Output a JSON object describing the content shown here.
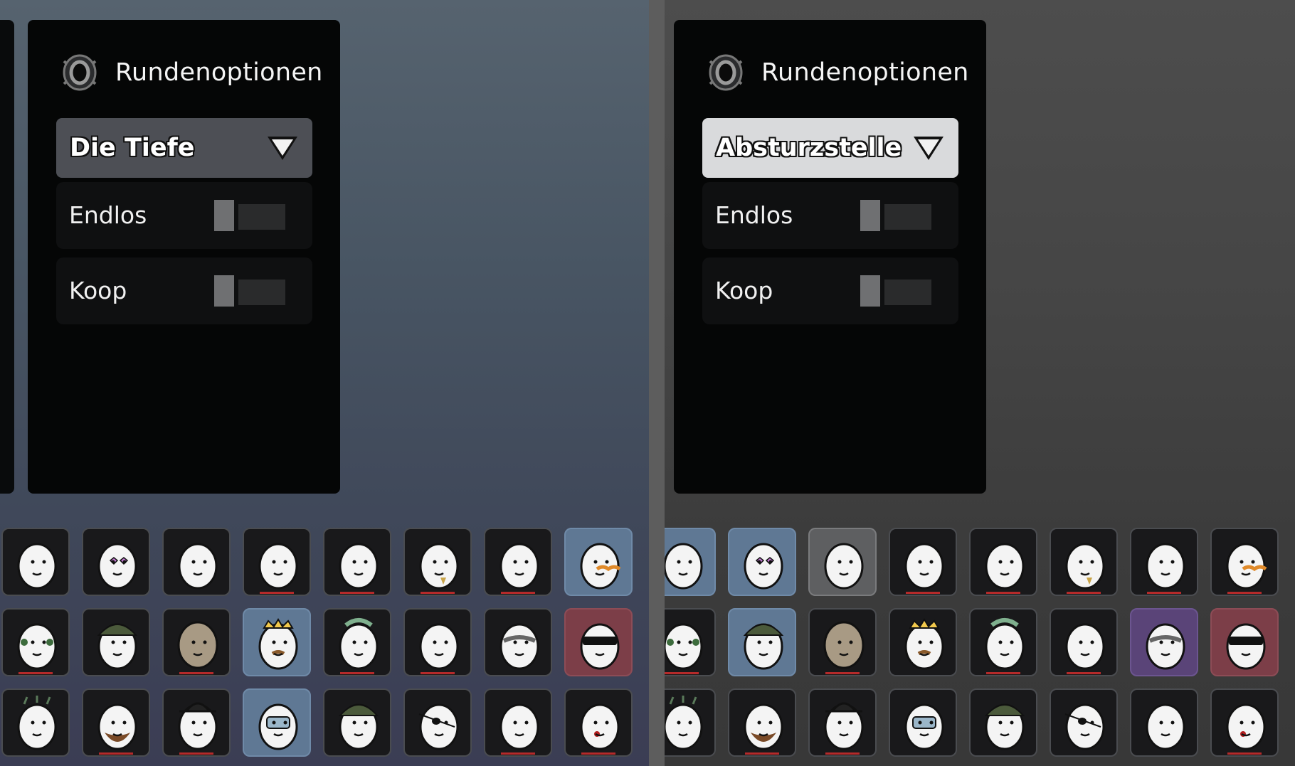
{
  "screens": [
    {
      "id": "left",
      "panel_title": "Rundenoptionen",
      "map_select": {
        "value": "Die Tiefe",
        "open": false,
        "icon": "chevron-down-icon"
      },
      "options": [
        {
          "label": "Endlos",
          "enabled": false
        },
        {
          "label": "Koop",
          "enabled": false
        }
      ],
      "character_rows": [
        [
          {
            "icon": "egg-sad-icon",
            "state": "none",
            "underline": false
          },
          {
            "icon": "egg-heart-glasses-icon",
            "state": "none",
            "underline": false
          },
          {
            "icon": "egg-worried-icon",
            "state": "none",
            "underline": false
          },
          {
            "icon": "egg-kiss-icon",
            "state": "none",
            "underline": true
          },
          {
            "icon": "egg-cigarette-icon",
            "state": "none",
            "underline": true
          },
          {
            "icon": "egg-goatee-icon",
            "state": "none",
            "underline": true
          },
          {
            "icon": "egg-shocked-icon",
            "state": "none",
            "underline": true
          },
          {
            "icon": "egg-mustache-icon",
            "state": "blue",
            "underline": false
          }
        ],
        [
          {
            "icon": "egg-bird-mask-icon",
            "state": "none",
            "underline": true
          },
          {
            "icon": "egg-bucket-hat-icon",
            "state": "none",
            "underline": false
          },
          {
            "icon": "egg-potato-icon",
            "state": "none",
            "underline": true
          },
          {
            "icon": "egg-crown-icon",
            "state": "blue",
            "underline": false
          },
          {
            "icon": "egg-punk-icon",
            "state": "none",
            "underline": true
          },
          {
            "icon": "egg-plain-icon",
            "state": "none",
            "underline": true
          },
          {
            "icon": "egg-spiked-collar-icon",
            "state": "none",
            "underline": false
          },
          {
            "icon": "egg-sunglasses-icon",
            "state": "red",
            "underline": false
          }
        ],
        [
          {
            "icon": "egg-zombie-icon",
            "state": "none",
            "underline": false
          },
          {
            "icon": "egg-bearded-icon",
            "state": "none",
            "underline": true
          },
          {
            "icon": "egg-fedora-icon",
            "state": "none",
            "underline": true
          },
          {
            "icon": "egg-diver-icon",
            "state": "blue",
            "underline": false
          },
          {
            "icon": "egg-beanie-icon",
            "state": "none",
            "underline": false
          },
          {
            "icon": "egg-pirate-icon",
            "state": "none",
            "underline": false
          },
          {
            "icon": "egg-pipe-icon",
            "state": "none",
            "underline": true
          },
          {
            "icon": "egg-rose-icon",
            "state": "none",
            "underline": true
          }
        ]
      ]
    },
    {
      "id": "right",
      "panel_title": "Rundenoptionen",
      "map_select": {
        "value": "Absturzstelle",
        "open": false,
        "icon": "chevron-down-icon"
      },
      "options": [
        {
          "label": "Endlos",
          "enabled": false
        },
        {
          "label": "Koop",
          "enabled": false
        }
      ],
      "character_rows": [
        [
          {
            "icon": "egg-sad-icon",
            "state": "blue",
            "underline": false
          },
          {
            "icon": "egg-heart-glasses-icon",
            "state": "blue",
            "underline": false
          },
          {
            "icon": "egg-worried-icon",
            "state": "gray",
            "underline": false
          },
          {
            "icon": "egg-kiss-icon",
            "state": "none",
            "underline": true
          },
          {
            "icon": "egg-cigarette-icon",
            "state": "none",
            "underline": true
          },
          {
            "icon": "egg-goatee-icon",
            "state": "none",
            "underline": true
          },
          {
            "icon": "egg-shocked-icon",
            "state": "none",
            "underline": true
          },
          {
            "icon": "egg-mustache-icon",
            "state": "none",
            "underline": true
          }
        ],
        [
          {
            "icon": "egg-bird-mask-icon",
            "state": "none",
            "underline": true
          },
          {
            "icon": "egg-bucket-hat-icon",
            "state": "blue",
            "underline": false
          },
          {
            "icon": "egg-potato-icon",
            "state": "none",
            "underline": true
          },
          {
            "icon": "egg-crown-icon",
            "state": "none",
            "underline": false
          },
          {
            "icon": "egg-punk-icon",
            "state": "none",
            "underline": true
          },
          {
            "icon": "egg-plain-icon",
            "state": "none",
            "underline": true
          },
          {
            "icon": "egg-spiked-collar-icon",
            "state": "purple",
            "underline": false
          },
          {
            "icon": "egg-sunglasses-icon",
            "state": "red",
            "underline": false
          }
        ],
        [
          {
            "icon": "egg-zombie-icon",
            "state": "none",
            "underline": false
          },
          {
            "icon": "egg-bearded-icon",
            "state": "none",
            "underline": true
          },
          {
            "icon": "egg-fedora-icon",
            "state": "none",
            "underline": true
          },
          {
            "icon": "egg-diver-icon",
            "state": "none",
            "underline": false
          },
          {
            "icon": "egg-beanie-icon",
            "state": "none",
            "underline": false
          },
          {
            "icon": "egg-pirate-icon",
            "state": "none",
            "underline": false
          },
          {
            "icon": "egg-pipe-icon",
            "state": "none",
            "underline": false
          },
          {
            "icon": "egg-rose-icon",
            "state": "none",
            "underline": true
          }
        ]
      ]
    }
  ],
  "colors": {
    "tile_selected_blue": "#5f7894",
    "tile_selected_red": "#7c3e48",
    "tile_selected_purple": "#5a4478",
    "tile_selected_gray": "#5e5f61",
    "unlock_underline": "#b52a2a"
  }
}
